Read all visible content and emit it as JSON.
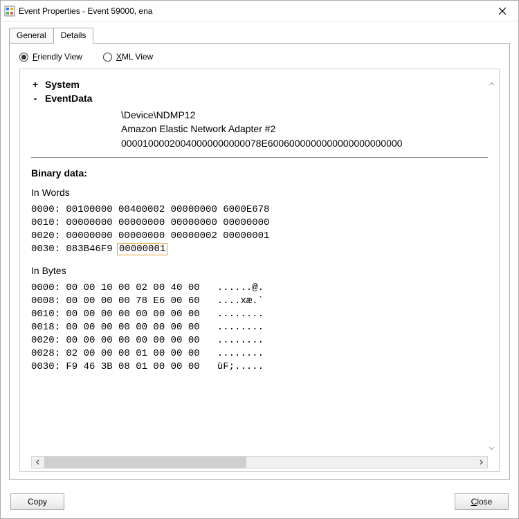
{
  "window": {
    "title": "Event Properties - Event 59000, ena"
  },
  "tabs": {
    "general": "General",
    "details": "Details"
  },
  "radios": {
    "friendly_u": "F",
    "friendly_rest": "riendly View",
    "xml_u": "X",
    "xml_rest": "ML View"
  },
  "tree": {
    "system_pm": "+",
    "system": "System",
    "eventdata_pm": "-",
    "eventdata": "EventData",
    "ev_val1": "\\Device\\NDMP12",
    "ev_val2": "Amazon Elastic Network Adapter #2",
    "ev_val3": "00001000020040000000000078E6006000000000000000000000"
  },
  "binary": {
    "title": "Binary data:",
    "words_label": "In Words",
    "words_l0": "0000: 00100000 00400002 00000000 6000E678",
    "words_l1": "0010: 00000000 00000000 00000000 00000000",
    "words_l2": "0020: 00000000 00000000 00000002 00000001",
    "words_l3_pre": "0030: 083B46F9 ",
    "words_l3_hl": "00000001",
    "bytes_label": "In Bytes",
    "bytes_l0": "0000: 00 00 10 00 02 00 40 00   ......@.",
    "bytes_l1": "0008: 00 00 00 00 78 E6 00 60   ....xæ.`",
    "bytes_l2": "0010: 00 00 00 00 00 00 00 00   ........",
    "bytes_l3": "0018: 00 00 00 00 00 00 00 00   ........",
    "bytes_l4": "0020: 00 00 00 00 00 00 00 00   ........",
    "bytes_l5": "0028: 02 00 00 00 01 00 00 00   ........",
    "bytes_l6": "0030: F9 46 3B 08 01 00 00 00   ùF;....."
  },
  "buttons": {
    "copy": "Copy",
    "close_u": "C",
    "close_rest": "lose"
  }
}
